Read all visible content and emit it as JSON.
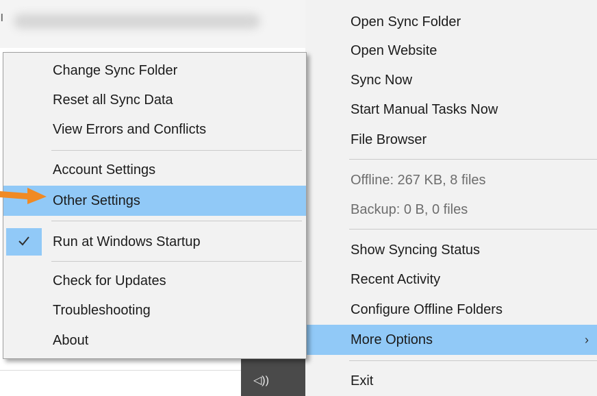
{
  "background": {
    "fragment": "ı"
  },
  "main_menu": {
    "items": [
      {
        "label": "Open Sync Folder"
      },
      {
        "label": "Open Website"
      },
      {
        "label": "Sync Now"
      },
      {
        "label": "Start Manual Tasks Now"
      },
      {
        "label": "File Browser"
      },
      {
        "label": "Offline: 267 KB, 8 files"
      },
      {
        "label": "Backup: 0 B, 0 files"
      },
      {
        "label": "Show Syncing Status"
      },
      {
        "label": "Recent Activity"
      },
      {
        "label": "Configure Offline Folders"
      },
      {
        "label": "More Options",
        "submenu_glyph": "›"
      },
      {
        "label": "Exit"
      }
    ]
  },
  "more_options_menu": {
    "items": [
      {
        "label": "Change Sync Folder"
      },
      {
        "label": "Reset all Sync Data"
      },
      {
        "label": "View Errors and Conflicts"
      },
      {
        "label": "Account Settings"
      },
      {
        "label": "Other Settings"
      },
      {
        "label": "Run at Windows Startup",
        "checked": true
      },
      {
        "label": "Check for Updates"
      },
      {
        "label": "Troubleshooting"
      },
      {
        "label": "About"
      }
    ]
  },
  "colors": {
    "highlight": "#91c9f7",
    "menu_bg": "#f2f2f2",
    "annotation_arrow": "#f08a24"
  },
  "icons": {
    "checkmark": "check-icon",
    "annotation": "orange-arrow-icon",
    "submenu": "chevron-right-icon",
    "taskbar": "speaker-icon"
  }
}
